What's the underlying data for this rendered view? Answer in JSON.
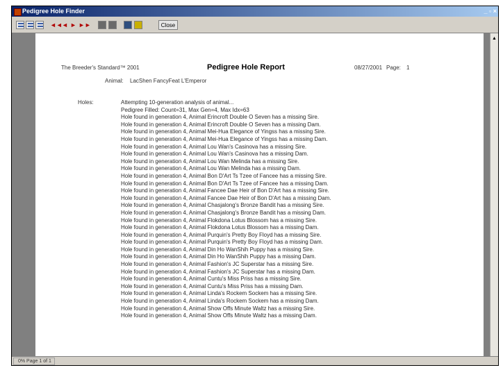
{
  "window": {
    "title": "Pedigree Hole Finder",
    "controls": "_ ▫ ×"
  },
  "toolbar": {
    "nav": [
      "◄◄",
      "◄",
      "►",
      "►►"
    ],
    "close_label": "Close"
  },
  "report": {
    "product": "The Breeder's Standard™ 2001",
    "title": "Pedigree Hole Report",
    "date": "08/27/2001",
    "page_label": "Page:",
    "page_number": "1",
    "animal_label": "Animal:",
    "animal_name": "LacShen FancyFeat L'Emperor",
    "holes_label": "Holes:",
    "lines": [
      "Attempting 10-generation analysis of animal...",
      "Pedigree Filled:  Count=31, Max Gen=4, Max Idx=63",
      "Hole found in generation 4, Animal Erincroft Double O Seven has a missing Sire.",
      "Hole found in generation 4, Animal Erincroft Double O Seven has a missing Dam.",
      "Hole found in generation 4, Animal Mei-Hua Elegance of Yingss has a missing Sire.",
      "Hole found in generation 4, Animal Mei-Hua Elegance of Yingss has a missing Dam.",
      "Hole found in generation 4, Animal Lou Wan's Casinova has a missing Sire.",
      "Hole found in generation 4, Animal Lou Wan's Casinova has a missing Dam.",
      "Hole found in generation 4, Animal Lou Wan Melinda has a missing Sire.",
      "Hole found in generation 4, Animal Lou Wan Melinda has a missing Dam.",
      "Hole found in generation 4, Animal Bon D'Art Ts Tzee of Fancee has a missing Sire.",
      "Hole found in generation 4, Animal Bon D'Art Ts Tzee of Fancee has a missing Dam.",
      "Hole found in generation 4, Animal Fancee Dae Heir of Bon D'Art has a missing Sire.",
      "Hole found in generation 4, Animal Fancee Dae Heir of Bon D'Art has a missing Dam.",
      "Hole found in generation 4, Animal Chasjalong's Bronze Bandit has a missing Sire.",
      "Hole found in generation 4, Animal Chasjalong's Bronze Bandit has a missing Dam.",
      "Hole found in generation 4, Animal Flokdona Lotus Blossom has a missing Sire.",
      "Hole found in generation 4, Animal Flokdona Lotus Blossom has a missing Dam.",
      "Hole found in generation 4, Animal Purquin's Pretty Boy Floyd has a missing Sire.",
      "Hole found in generation 4, Animal Purquin's Pretty Boy Floyd has a missing Dam.",
      "Hole found in generation 4, Animal Din Ho WanShih Puppy has a missing Sire.",
      "Hole found in generation 4, Animal Din Ho WanShih Puppy has a missing Dam.",
      "Hole found in generation 4, Animal Fashion's JC Superstar has a missing Sire.",
      "Hole found in generation 4, Animal Fashion's JC Superstar has a missing Dam.",
      "Hole found in generation 4, Animal Cuntu's Miss Priss has a missing Sire.",
      "Hole found in generation 4, Animal Cuntu's Miss Priss has a missing Dam.",
      "Hole found in generation 4, Animal Linda's Rockem Sockem has a missing Sire.",
      "Hole found in generation 4, Animal Linda's Rockem Sockem has a missing Dam.",
      "Hole found in generation 4, Animal Show Offs Minute Waltz has a missing Sire.",
      "Hole found in generation 4, Animal Show Offs Minute Waltz has a missing Dam."
    ]
  },
  "status": {
    "text": "0% Page 1 of 1"
  },
  "colors": {
    "titlebar": "#0a246a",
    "viewport_bg": "#808080",
    "nav_arrows": "#b00000"
  },
  "icons": [
    "app-icon",
    "single-page-icon",
    "two-page-icon",
    "multi-page-icon",
    "print-icon",
    "print-setup-icon",
    "save-icon",
    "export-icon"
  ]
}
